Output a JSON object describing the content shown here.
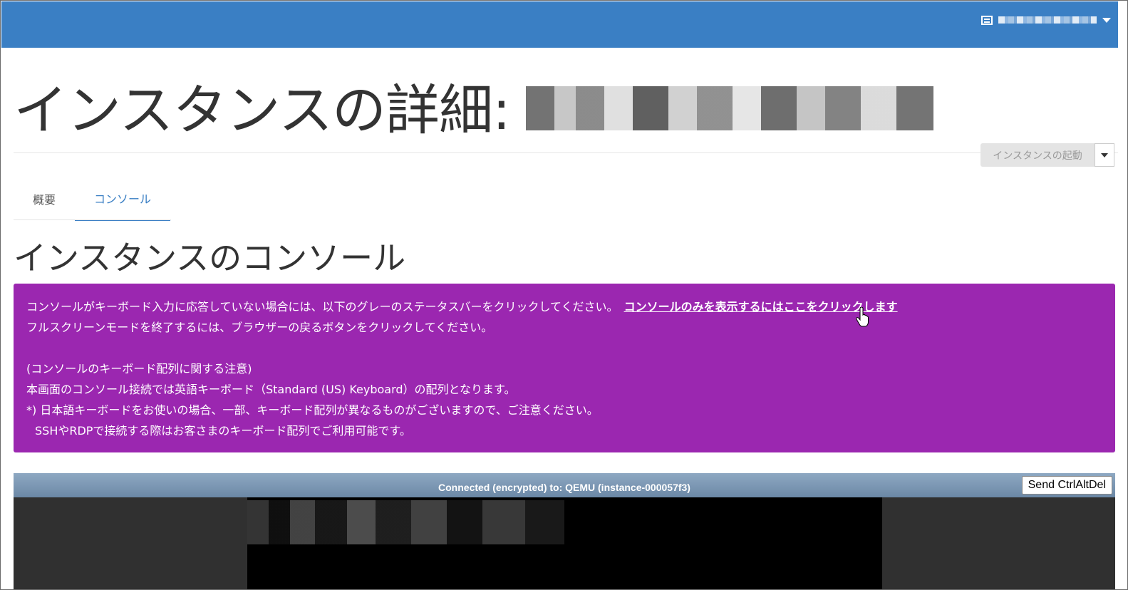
{
  "header": {
    "user_menu_icon": "server-list-icon",
    "user_name": "",
    "user_caret_icon": "caret-down-icon"
  },
  "page": {
    "title_prefix": "インスタンスの詳細:",
    "instance_name": ""
  },
  "actions": {
    "launch_label": "インスタンスの起動",
    "launch_caret_icon": "caret-down-icon"
  },
  "tabs": [
    {
      "label": "概要",
      "active": false
    },
    {
      "label": "コンソール",
      "active": true
    }
  ],
  "section_title": "インスタンスのコンソール",
  "notice": {
    "line1": "コンソールがキーボード入力に応答していない場合には、以下のグレーのステータスバーをクリックしてください。",
    "link": "コンソールのみを表示するにはここをクリックします",
    "line2": "フルスクリーンモードを終了するには、ブラウザーの戻るボタンをクリックしてください。",
    "line3": "(コンソールのキーボード配列に関する注意)",
    "line4": "本画面のコンソール接続では英語キーボード（Standard (US) Keyboard）の配列となります。",
    "line5": "*) 日本語キーボードをお使いの場合、一部、キーボード配列が異なるものがございますので、ご注意ください。",
    "line6": "SSHやRDPで接続する際はお客さまのキーボード配列でご利用可能です。",
    "background": "#9b27b0"
  },
  "console": {
    "status": "Connected (encrypted) to: QEMU (instance-000057f3)",
    "ctrl_alt_del_label": "Send CtrlAltDel"
  },
  "colors": {
    "topbar": "#3a7fc4",
    "accent": "#3a7fc4"
  }
}
